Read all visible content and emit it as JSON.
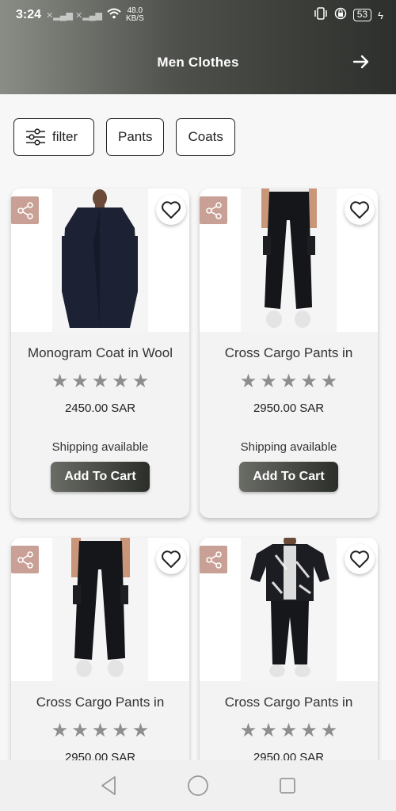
{
  "status_bar": {
    "time": "3:24",
    "net_speed": "48.0",
    "net_unit": "KB/S",
    "battery": "53"
  },
  "header": {
    "title": "Men Clothes"
  },
  "chips": [
    {
      "label": "filter"
    },
    {
      "label": "Pants"
    },
    {
      "label": "Coats"
    }
  ],
  "products": [
    {
      "name": "Monogram Coat in Wool",
      "rating": 5,
      "price": "2450.00",
      "currency": "SAR",
      "shipping": "Shipping available",
      "cart_label": "Add To Cart"
    },
    {
      "name": "Cross Cargo Pants in",
      "rating": 5,
      "price": "2950.00",
      "currency": "SAR",
      "shipping": "Shipping available",
      "cart_label": "Add To Cart"
    },
    {
      "name": "Cross Cargo Pants in",
      "rating": 5,
      "price": "2950.00",
      "currency": "SAR"
    },
    {
      "name": "Cross Cargo Pants in",
      "rating": 5,
      "price": "2950.00",
      "currency": "SAR"
    }
  ],
  "colors": {
    "share_bg": "#c9a096",
    "star": "#8e8e8e",
    "button_dark": "#2b2e29"
  }
}
